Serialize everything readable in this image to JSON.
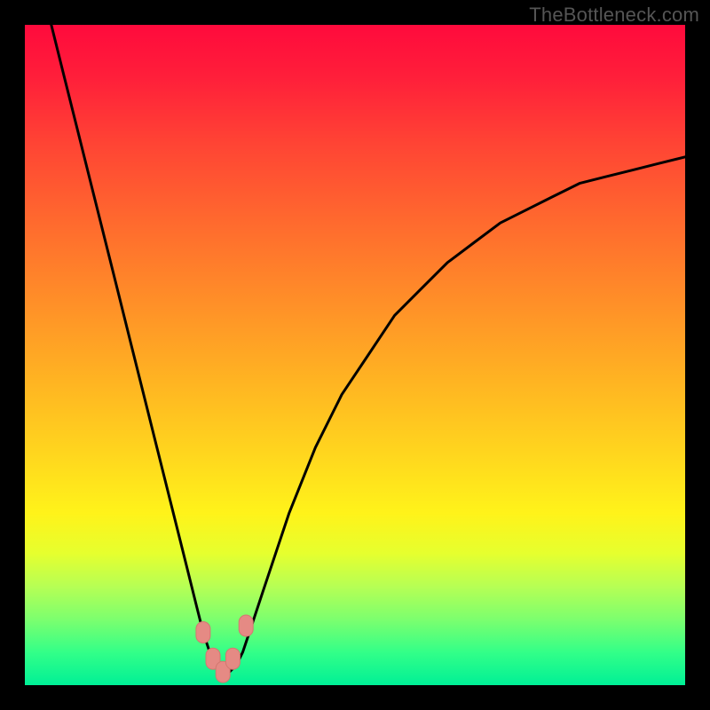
{
  "credit": "TheBottleneck.com",
  "chart_data": {
    "type": "line",
    "title": "",
    "xlabel": "",
    "ylabel": "",
    "x_range": [
      0,
      100
    ],
    "y_range": [
      0,
      100
    ],
    "series": [
      {
        "name": "bottleneck-curve",
        "x": [
          4,
          6,
          8,
          10,
          12,
          14,
          16,
          18,
          20,
          22,
          24,
          26,
          27,
          28,
          29,
          30,
          31,
          32,
          33,
          34,
          36,
          38,
          40,
          44,
          48,
          52,
          56,
          60,
          64,
          68,
          72,
          76,
          80,
          84,
          88,
          92,
          96,
          100
        ],
        "y": [
          100,
          92,
          84,
          76,
          68,
          60,
          52,
          44,
          36,
          28,
          20,
          12,
          8,
          5,
          3,
          2,
          2,
          3,
          5,
          8,
          14,
          20,
          26,
          36,
          44,
          50,
          56,
          60,
          64,
          67,
          70,
          72,
          74,
          76,
          77,
          78,
          79,
          80
        ]
      }
    ],
    "markers": [
      {
        "name": "marker-left-upper",
        "x": 27.0,
        "y": 8.0
      },
      {
        "name": "marker-left-lower",
        "x": 28.5,
        "y": 4.0
      },
      {
        "name": "marker-bottom",
        "x": 30.0,
        "y": 2.0
      },
      {
        "name": "marker-right-lower",
        "x": 31.5,
        "y": 4.0
      },
      {
        "name": "marker-right-upper",
        "x": 33.5,
        "y": 9.0
      }
    ],
    "background_gradient": {
      "top": "#ff0a3c",
      "mid": "#ffd61e",
      "bottom": "#00f096"
    }
  }
}
